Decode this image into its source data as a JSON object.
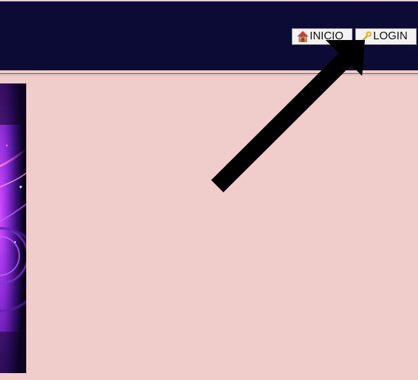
{
  "header": {
    "nav": {
      "home_label": "INICIO",
      "login_label": "LOGIN",
      "home_icon": "house-icon",
      "login_icon": "key-icon"
    }
  },
  "colors": {
    "page_background": "#f0cdcb",
    "header_background": "#0c0b36",
    "button_background": "#f3f3f3",
    "arrow": "#000000"
  }
}
